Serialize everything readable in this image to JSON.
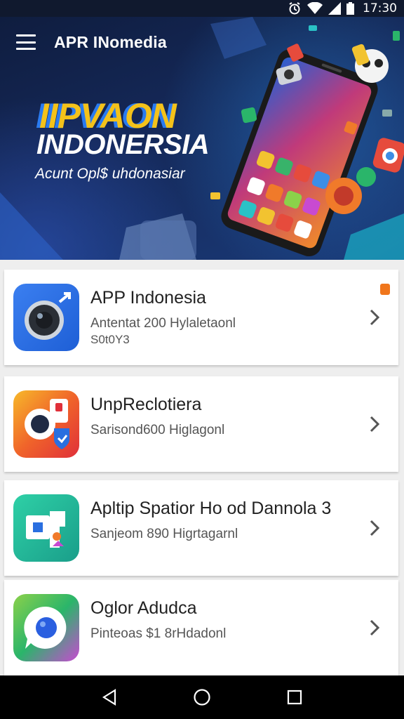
{
  "status_bar": {
    "time": "17:30",
    "icons": [
      "alarm-icon",
      "wifi-icon",
      "signal-icon",
      "battery-icon"
    ]
  },
  "header": {
    "menu_icon": "hamburger-menu-icon",
    "title": "APR INomedia"
  },
  "hero": {
    "title_line1": "IIPVAON",
    "title_line2": "INDONERSIA",
    "subtitle": "Acunt Opl$ uhdonasiar",
    "colors": {
      "title_yellow": "#f4c21a",
      "title_blue": "#2a7bf0",
      "bg_dark": "#0f1d3f"
    }
  },
  "apps": [
    {
      "title": "APP Indonesia",
      "line1": "Antentat 200 Hylaletaonl",
      "line2": "S0t0Y3",
      "icon": "camera-lens-icon",
      "badge": true
    },
    {
      "title": "UnpReclotiera",
      "line1": "Sarisond600 Higlagonl",
      "line2": "",
      "icon": "camera-shield-icon",
      "badge": false
    },
    {
      "title": "Apltip Spatior Ho od Dannola 3",
      "line1": "Sanjeom 890 Higrtagarnl",
      "line2": "",
      "icon": "photo-edit-icon",
      "badge": false
    },
    {
      "title": "Oglor Adudca",
      "line1": "Pinteoas $1 8rHdadonl",
      "line2": "",
      "icon": "camera-circle-icon",
      "badge": false
    }
  ],
  "navigation": {
    "back": "back-icon",
    "home": "home-icon",
    "recents": "recents-icon"
  }
}
